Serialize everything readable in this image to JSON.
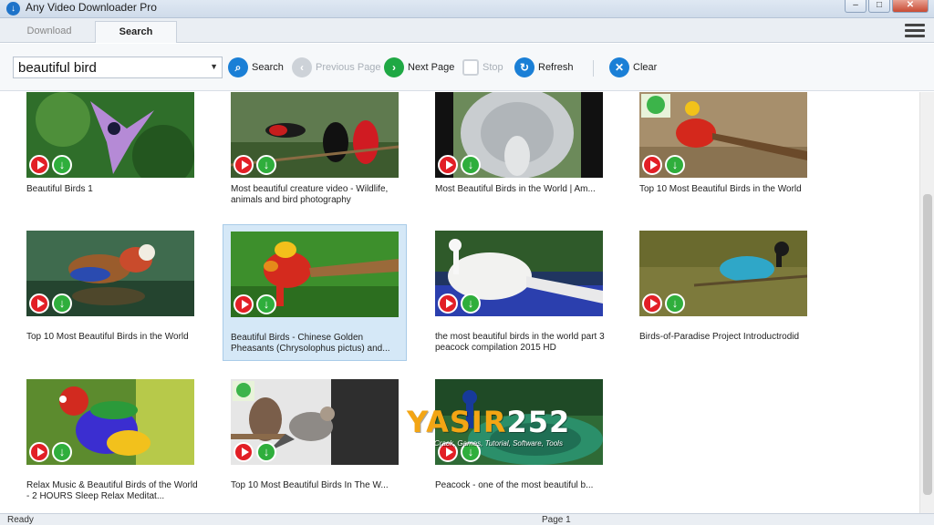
{
  "window": {
    "title": "Any Video Downloader Pro"
  },
  "tabs": [
    {
      "label": "Download",
      "active": false
    },
    {
      "label": "Search",
      "active": true
    }
  ],
  "toolbar": {
    "search_value": "beautiful bird",
    "search_label": "Search",
    "previous_label": "Previous Page",
    "next_label": "Next Page",
    "stop_label": "Stop",
    "refresh_label": "Refresh",
    "clear_label": "Clear"
  },
  "results": [
    {
      "title": "Beautiful Birds 1"
    },
    {
      "title": "Most beautiful creature video - Wildlife, animals and bird photography"
    },
    {
      "title": "Most Beautiful Birds in the World | Am..."
    },
    {
      "title": "Top 10 Most Beautiful Birds in the World"
    },
    {
      "title": "Top 10 Most Beautiful Birds in the World"
    },
    {
      "title": "Beautiful Birds - Chinese Golden Pheasants (Chrysolophus pictus) and...",
      "selected": true
    },
    {
      "title": "the most beautiful birds in the world part 3   peacock compilation 2015  HD"
    },
    {
      "title": "Birds-of-Paradise Project Introductrodid"
    },
    {
      "title": "Relax Music & Beautiful Birds of the World - 2 HOURS Sleep Relax Meditat..."
    },
    {
      "title": "Top 10 Most Beautiful Birds In The W..."
    },
    {
      "title": "Peacock - one of the most beautiful b..."
    }
  ],
  "status": {
    "left": "Ready",
    "page": "Page 1"
  },
  "watermark": {
    "main_a": "YASIR",
    "main_b": "252",
    "sub": "Crack, Games, Tutorial, Software, Tools"
  },
  "colors": {
    "play": "#e21f26",
    "download": "#2fae3c",
    "accent": "#1a7fd6",
    "selected": "#d5e8f7"
  }
}
